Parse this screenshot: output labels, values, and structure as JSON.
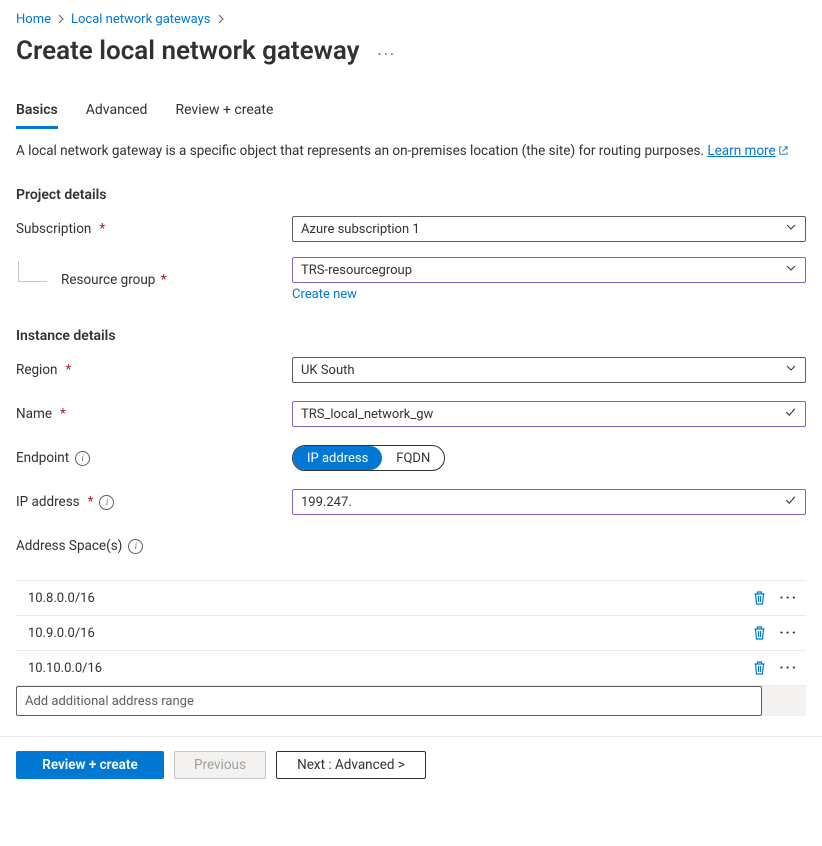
{
  "breadcrumb": {
    "home": "Home",
    "section": "Local network gateways"
  },
  "page": {
    "title": "Create local network gateway"
  },
  "tabs": {
    "basics": "Basics",
    "advanced": "Advanced",
    "review": "Review + create"
  },
  "description": {
    "text": "A local network gateway is a specific object that represents an on-premises location (the site) for routing purposes. ",
    "learn_more": "Learn more"
  },
  "project": {
    "heading": "Project details",
    "subscription_label": "Subscription",
    "subscription_value": "Azure subscription 1",
    "rg_label": "Resource group",
    "rg_value": "TRS-resourcegroup",
    "create_new": "Create new"
  },
  "instance": {
    "heading": "Instance details",
    "region_label": "Region",
    "region_value": "UK South",
    "name_label": "Name",
    "name_value": "TRS_local_network_gw",
    "endpoint_label": "Endpoint",
    "endpoint_opts": {
      "ip": "IP address",
      "fqdn": "FQDN"
    },
    "ip_label": "IP address",
    "ip_value": "199.247.",
    "addr_label": "Address Space(s)",
    "addresses": [
      "10.8.0.0/16",
      "10.9.0.0/16",
      "10.10.0.0/16"
    ],
    "addr_placeholder": "Add additional address range"
  },
  "footer": {
    "review": "Review + create",
    "previous": "Previous",
    "next": "Next : Advanced >"
  }
}
